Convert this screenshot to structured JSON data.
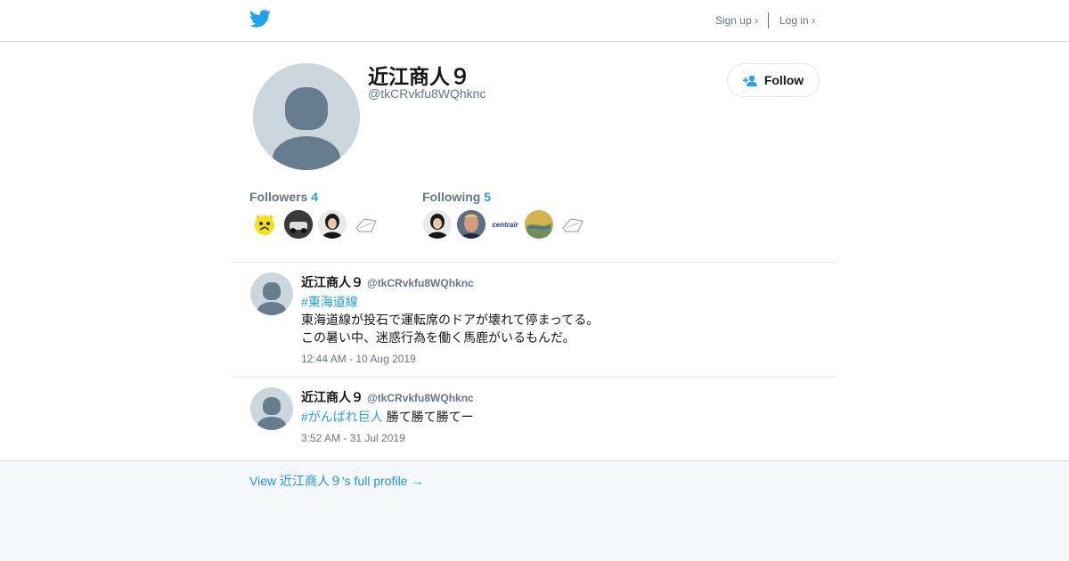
{
  "header": {
    "signup_label": "Sign up ›",
    "login_label": "Log in ›",
    "brand_color": "#1da1f2"
  },
  "profile": {
    "name": "近江商人９",
    "handle": "@tkCRvkfu8WQhknc",
    "follow_label": "Follow"
  },
  "stats": {
    "followers_label": "Followers",
    "followers_count": "4",
    "following_label": "Following",
    "following_count": "5",
    "following_thumb_text": "centrair"
  },
  "tweets": [
    {
      "name": "近江商人９",
      "handle": "@tkCRvkfu8WQhknc",
      "hashtag": "#東海道線",
      "line1": "東海道線が投石で運転席のドアが壊れて停まってる。",
      "line2": "この暑い中、迷惑行為を働く馬鹿がいるもんだ。",
      "date": "12:44 AM - 10 Aug 2019"
    },
    {
      "name": "近江商人９",
      "handle": "@tkCRvkfu8WQhknc",
      "hashtag": "#がんばれ巨人",
      "text": " 勝て勝て勝てー",
      "date": "3:52 AM - 31 Jul 2019"
    }
  ],
  "footer": {
    "link_label": "View 近江商人９'s full profile →"
  }
}
